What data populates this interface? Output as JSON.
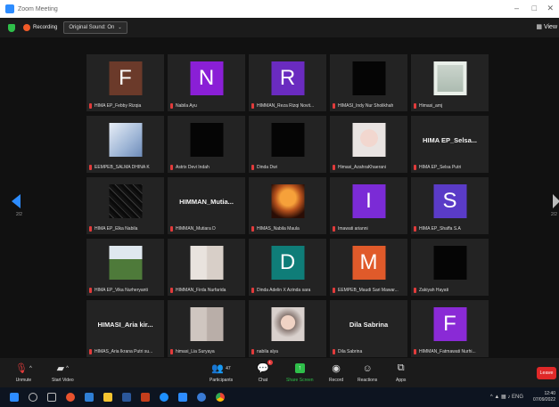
{
  "window": {
    "title": "Zoom Meeting",
    "controls": [
      "–",
      "□",
      "✕"
    ]
  },
  "topbar": {
    "recording_label": "Recording",
    "original_sound": "Original Sound: On",
    "view_label": "View"
  },
  "gallery": {
    "page_left": "2/2",
    "page_right": "2/2",
    "tiles": [
      {
        "name": "HIMA EP_Febby Rizqia",
        "avatar_letter": "F",
        "avatar_color": "#6b3a2a"
      },
      {
        "name": "Nabila Ayu",
        "avatar_letter": "N",
        "avatar_color": "#8a1fd6"
      },
      {
        "name": "HIMMAN_Reza Rizqi Novit...",
        "avatar_letter": "R",
        "avatar_color": "#6a2bc0"
      },
      {
        "name": "HIMASI_Indy Nur Sholikhah"
      },
      {
        "name": "Himasi_amj"
      },
      {
        "name": "EEMPEB_SALMA DHINA K"
      },
      {
        "name": "Astrix Devi Indah"
      },
      {
        "name": "Dinda Dwi"
      },
      {
        "name": "Himasi_AzahraKhaerani"
      },
      {
        "name": "HIMA EP_Selsa Putri",
        "big_text": "HIMA EP_Selsa..."
      },
      {
        "name": "HIMA EP_Elka Nabila"
      },
      {
        "name": "HIMMAN_Mutiara D",
        "big_text": "HIMMAN_Mutia..."
      },
      {
        "name": "HIMAS_Nabila Maula"
      },
      {
        "name": "Imawati arianni",
        "avatar_letter": "I",
        "avatar_color": "#7b2bd6"
      },
      {
        "name": "HIMA EP_Shaffa S.A",
        "avatar_letter": "S",
        "avatar_color": "#5a3bc7"
      },
      {
        "name": "HIMA EP_Vika Nurheryanti"
      },
      {
        "name": "HIMMAN_Firda Nurfarida"
      },
      {
        "name": "Dinda Adelin X Azinda sara",
        "avatar_letter": "D",
        "avatar_color": "#0f7d78"
      },
      {
        "name": "EEMPEB_Maudi Sari Mawar...",
        "avatar_letter": "M",
        "avatar_color": "#e05a2a"
      },
      {
        "name": "Zakiyah Hayati"
      },
      {
        "name": "HIMAS_Aria Ikrana Putri su...",
        "big_text": "HIMASI_Aria kir..."
      },
      {
        "name": "himasi_Lia Suryaya"
      },
      {
        "name": "nabila alya"
      },
      {
        "name": "Dila Sabrina",
        "big_text": "Dila Sabrina"
      },
      {
        "name": "HIMMAN_Fatmawati Nurhi...",
        "avatar_letter": "F",
        "avatar_color": "#8a2ad6"
      }
    ]
  },
  "toolbar": {
    "unmute": "Unmute",
    "start_video": "Start Video",
    "participants": "Participants",
    "participants_count": "47",
    "chat": "Chat",
    "chat_badge": "1",
    "share_screen": "Share Screen",
    "record": "Record",
    "reactions": "Reactions",
    "apps": "Apps",
    "leave": "Leave"
  },
  "taskbar": {
    "lang": "ENG",
    "time": "12:40",
    "date": "07/09/2022"
  }
}
